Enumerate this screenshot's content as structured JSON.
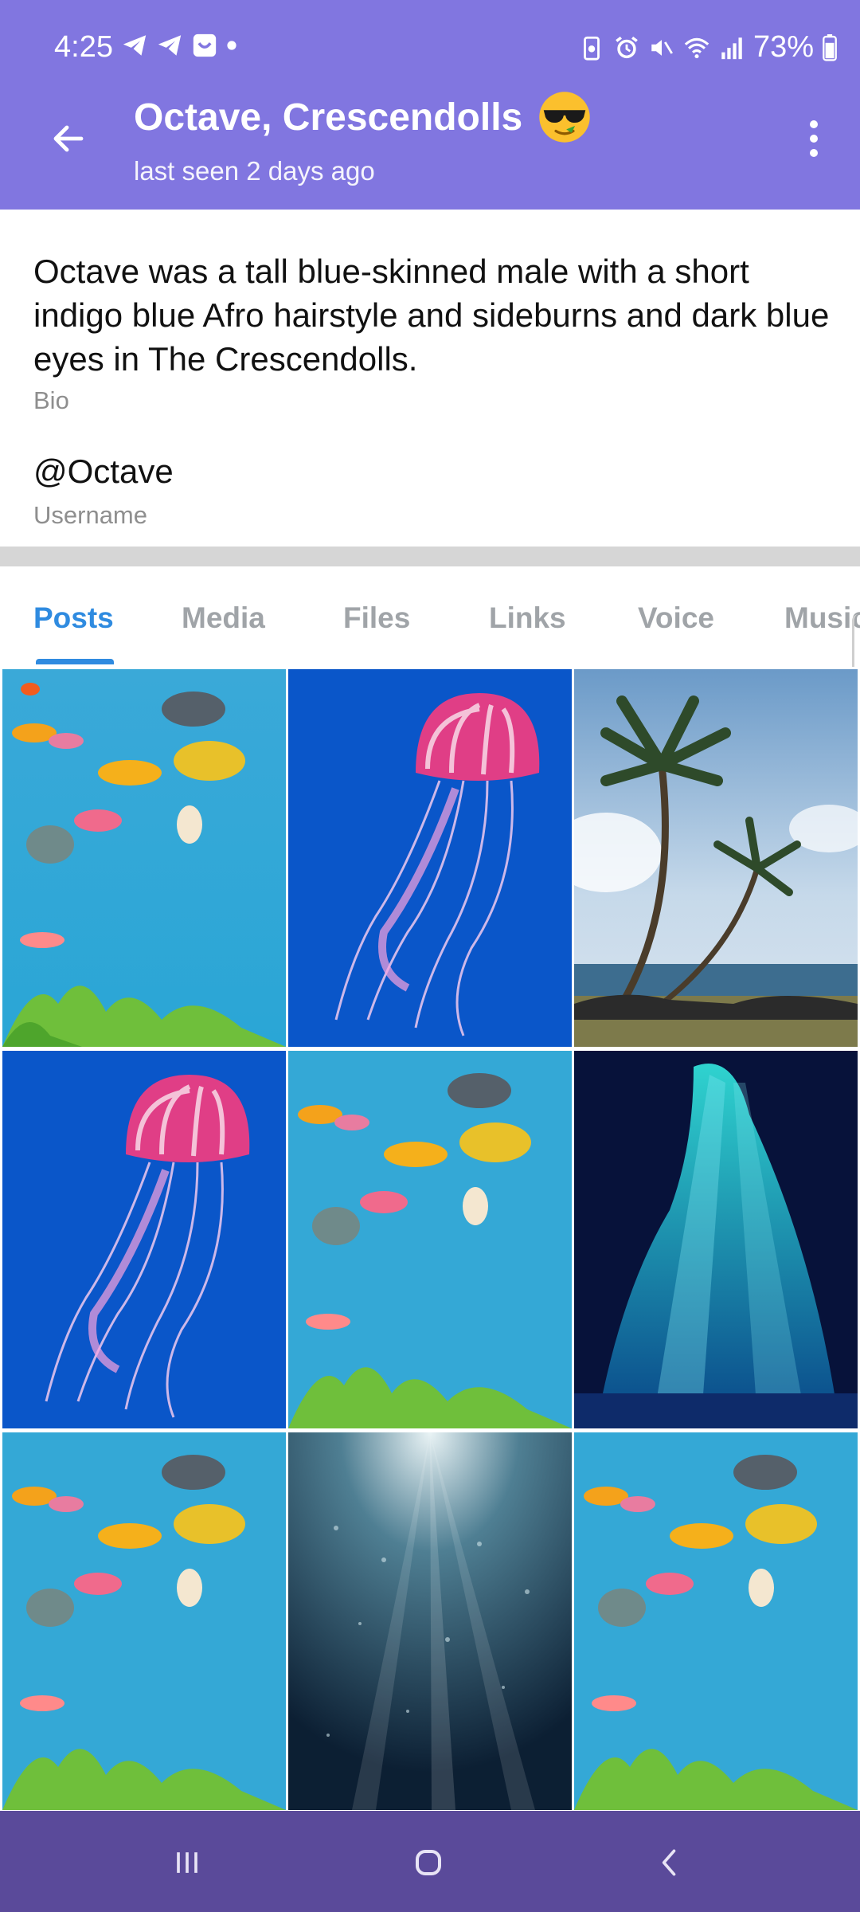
{
  "status_bar": {
    "time": "4:25",
    "battery": "73%",
    "icons_left": [
      "telegram-icon",
      "telegram-icon",
      "app-icon",
      "dot-icon"
    ],
    "icons_right": [
      "battery-saver-icon",
      "alarm-icon",
      "mute-icon",
      "wifi-icon",
      "signal-icon",
      "battery-icon"
    ]
  },
  "header": {
    "title": "Octave, Crescendolls",
    "emoji": "sunglasses-emoji",
    "subtitle": "last seen 2 days ago",
    "bg_color": "#8176e0"
  },
  "profile": {
    "bio": "Octave was a tall blue-skinned male with a short indigo blue Afro hairstyle and sideburns and dark blue eyes in The Crescendolls.",
    "bio_label": "Bio",
    "username": "@Octave",
    "username_label": "Username"
  },
  "tabs": [
    {
      "label": "Posts",
      "active": true
    },
    {
      "label": "Media",
      "active": false
    },
    {
      "label": "Files",
      "active": false
    },
    {
      "label": "Links",
      "active": false
    },
    {
      "label": "Voice",
      "active": false
    },
    {
      "label": "Music",
      "active": false
    }
  ],
  "media": [
    {
      "type": "aquarium-fish"
    },
    {
      "type": "jellyfish"
    },
    {
      "type": "palm-trees"
    },
    {
      "type": "jellyfish"
    },
    {
      "type": "aquarium-fish"
    },
    {
      "type": "underwater-cave"
    },
    {
      "type": "aquarium-fish"
    },
    {
      "type": "underwater-sunrays"
    },
    {
      "type": "aquarium-fish"
    }
  ],
  "nav": [
    "recent-apps-icon",
    "home-icon",
    "back-icon"
  ],
  "colors": {
    "accent": "#2f8be0",
    "header": "#8176e0",
    "navbar": "#5a4a9a"
  }
}
